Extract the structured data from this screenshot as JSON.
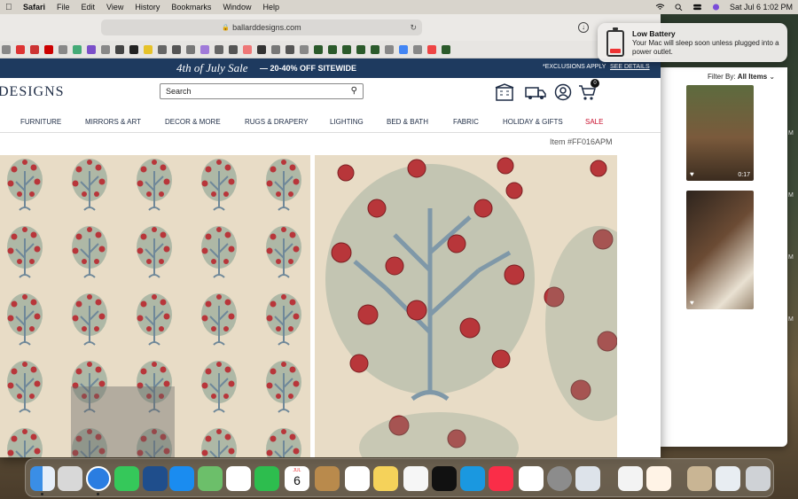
{
  "menubar": {
    "app": "Safari",
    "items": [
      "File",
      "Edit",
      "View",
      "History",
      "Bookmarks",
      "Window",
      "Help"
    ],
    "datetime": "Sat Jul 6  1:02 PM"
  },
  "browser": {
    "url": "ballarddesigns.com"
  },
  "notification": {
    "title": "Low Battery",
    "body": "Your Mac will sleep soon unless plugged into a power outlet."
  },
  "promo": {
    "sale_title": "4th of July Sale",
    "offer": "— 20-40% OFF SITEWIDE",
    "exclusions": "*EXCLUSIONS APPLY",
    "details_link": "SEE DETAILS"
  },
  "header": {
    "logo": "DESIGNS",
    "search_placeholder": "Search",
    "cart_count": "0"
  },
  "nav": [
    "FURNITURE",
    "MIRRORS & ART",
    "DECOR & MORE",
    "RUGS & DRAPERY",
    "LIGHTING",
    "BED & BATH",
    "FABRIC",
    "HOLIDAY & GIFTS",
    "SALE"
  ],
  "product": {
    "item_number": "Item #FF016APM"
  },
  "sidepanel": {
    "filter_label": "Filter By:",
    "filter_value": "All Items",
    "video1_duration": "0:17",
    "edge_labels": [
      "M",
      "M",
      "M",
      "M"
    ]
  },
  "calendar": {
    "month": "JUL",
    "day": "6"
  },
  "colors": {
    "promo_bg": "#1e3a5f",
    "nav_sale": "#c8102e",
    "fabric_bg": "#e8dcc6"
  }
}
